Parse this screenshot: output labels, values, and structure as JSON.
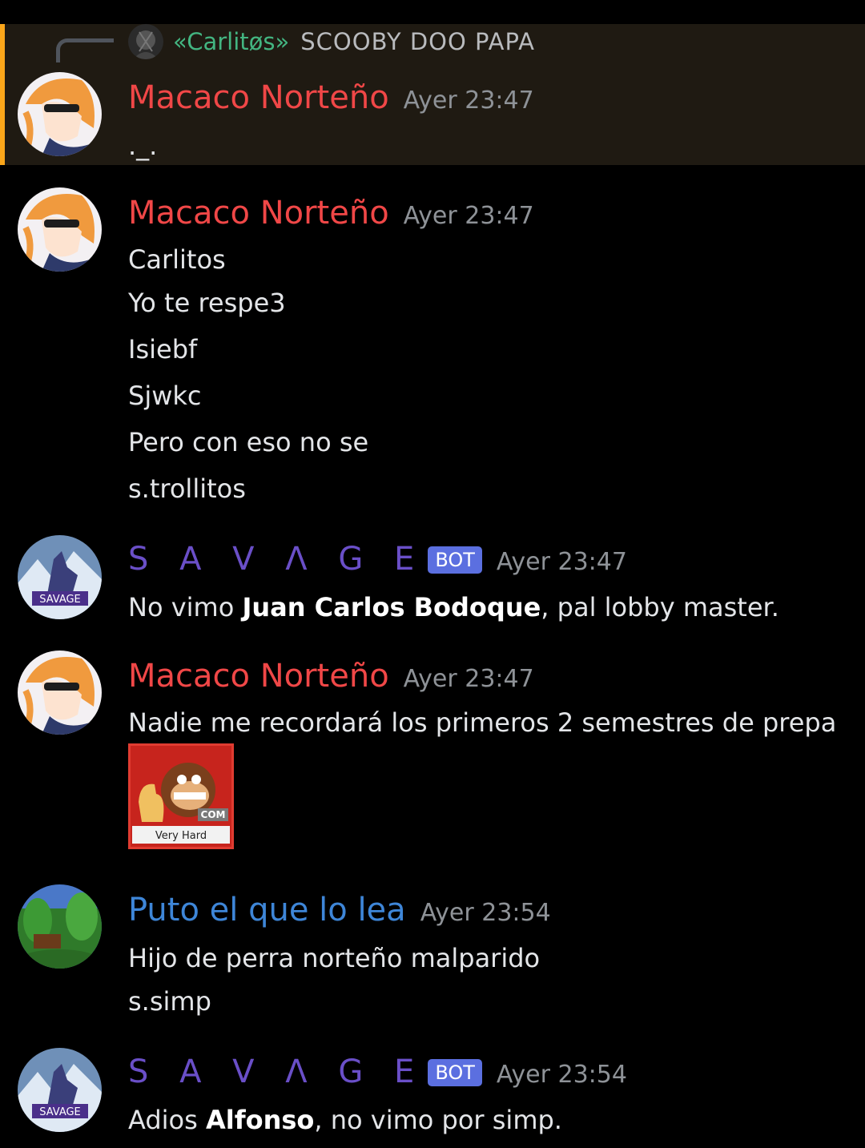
{
  "messages": [
    {
      "author": "Macaco Norteño",
      "time": "Ayer 23:47",
      "reply": {
        "author": "«Carlitøs»",
        "text": "SCOOBY DOO PAPA"
      },
      "lines": [
        "._."
      ]
    },
    {
      "author": "Macaco Norteño",
      "time": "Ayer 23:47",
      "lines": [
        "Carlitos",
        "Yo te respe3",
        "Isiebf",
        "Sjwkc",
        "Pero con eso no se",
        "s.trollitos"
      ]
    },
    {
      "author": "S A V Λ G E",
      "badge": "BOT",
      "time": "Ayer 23:47",
      "line": {
        "pre": "No vimo ",
        "bold": "Juan Carlos Bodoque",
        "post": ", pal lobby master."
      }
    },
    {
      "author": "Macaco Norteño",
      "time": "Ayer 23:47",
      "lines": [
        "Nadie me recordará los primeros 2 semestres de prepa"
      ],
      "attachment": {
        "caption": "Very Hard",
        "tag": "COM"
      }
    },
    {
      "author": "Puto el que lo lea",
      "time": "Ayer 23:54",
      "lines": [
        "Hijo de perra norteño malparido",
        "s.simp"
      ]
    },
    {
      "author": "S A V Λ G E",
      "badge": "BOT",
      "time": "Ayer 23:54",
      "line": {
        "pre": "Adios ",
        "bold": "Alfonso",
        "post": ", no vimo por simp."
      }
    }
  ],
  "colors": {
    "background": "#000000",
    "highlight_bar": "#faa61a",
    "name_red": "#f04747",
    "name_purple": "#6a4fc8",
    "name_blue": "#3e86d8",
    "reply_green": "#43b581",
    "bot_badge": "#5b6fe0"
  }
}
